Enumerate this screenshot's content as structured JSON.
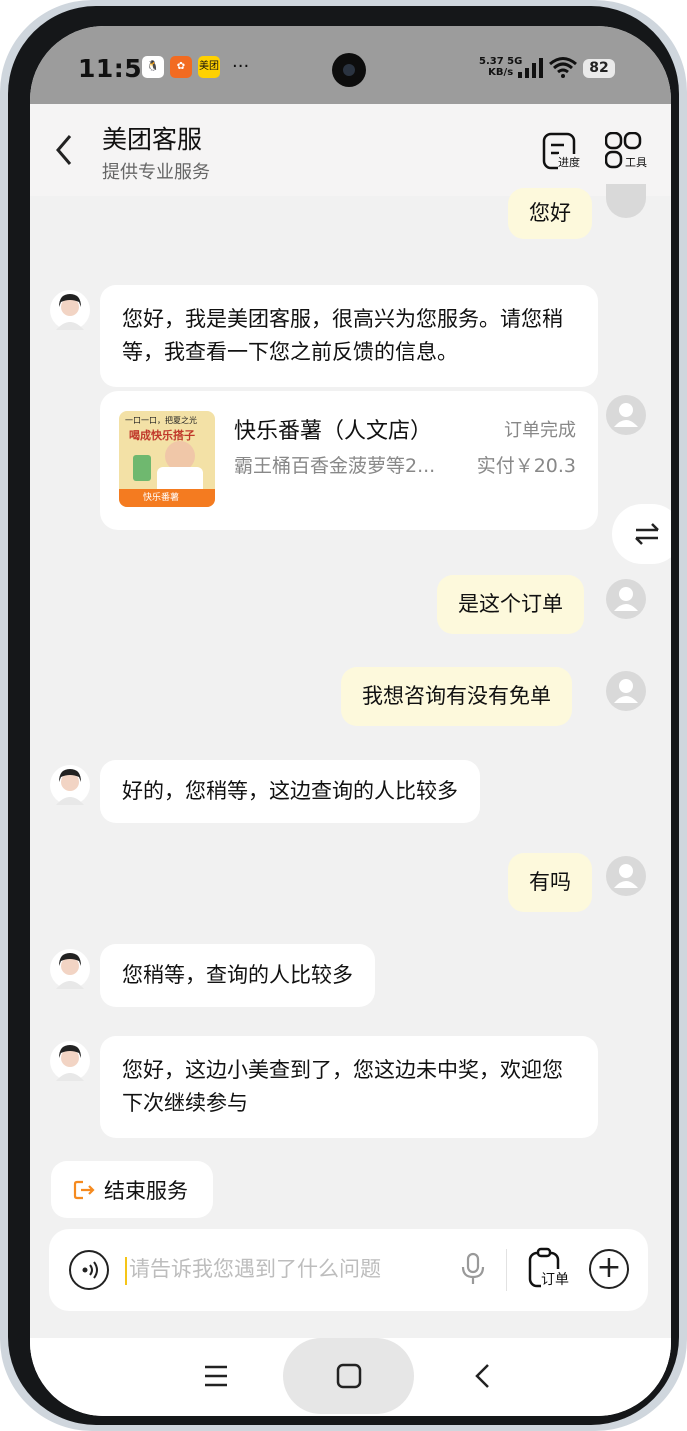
{
  "status_bar": {
    "time": "11:56",
    "app_icons": [
      "qq-icon",
      "ant-forest-icon",
      "meituan-icon"
    ],
    "more": "···",
    "net_speed_value": "5.37",
    "net_type": "5G",
    "net_speed_unit": "KB/s",
    "battery": "82"
  },
  "header": {
    "title": "美团客服",
    "subtitle": "提供专业服务",
    "progress_label": "进度",
    "tools_label": "工具"
  },
  "messages": [
    {
      "side": "user",
      "text": "您好"
    },
    {
      "side": "bot",
      "text": "您好，我是美团客服，很高兴为您服务。请您稍等，我查看一下您之前反馈的信息。"
    },
    {
      "side": "user",
      "text": "是这个订单"
    },
    {
      "side": "user",
      "text": "我想咨询有没有免单"
    },
    {
      "side": "bot",
      "text": "好的，您稍等，这边查询的人比较多"
    },
    {
      "side": "user",
      "text": "有吗"
    },
    {
      "side": "bot",
      "text": "您稍等，查询的人比较多"
    },
    {
      "side": "bot",
      "text": "您好，这边小美查到了，您这边未中奖，欢迎您下次继续参与"
    }
  ],
  "order_card": {
    "shop": "快乐番薯（人文店）",
    "status": "订单完成",
    "items": "霸王桶百香金菠萝等2...",
    "paid": "实付￥20.3",
    "image_text_1": "一口一口，把夏之光",
    "image_text_2": "喝成快乐搭子",
    "image_brand": "快乐番薯"
  },
  "end_service": {
    "label": "结束服务"
  },
  "input": {
    "placeholder": "请告诉我您遇到了什么问题",
    "value": "",
    "order_label": "订单"
  },
  "colors": {
    "user_bubble": "#fdf9dc",
    "bot_bubble": "#ffffff",
    "accent_orange": "#f58a1f",
    "caret": "#f5c518"
  }
}
